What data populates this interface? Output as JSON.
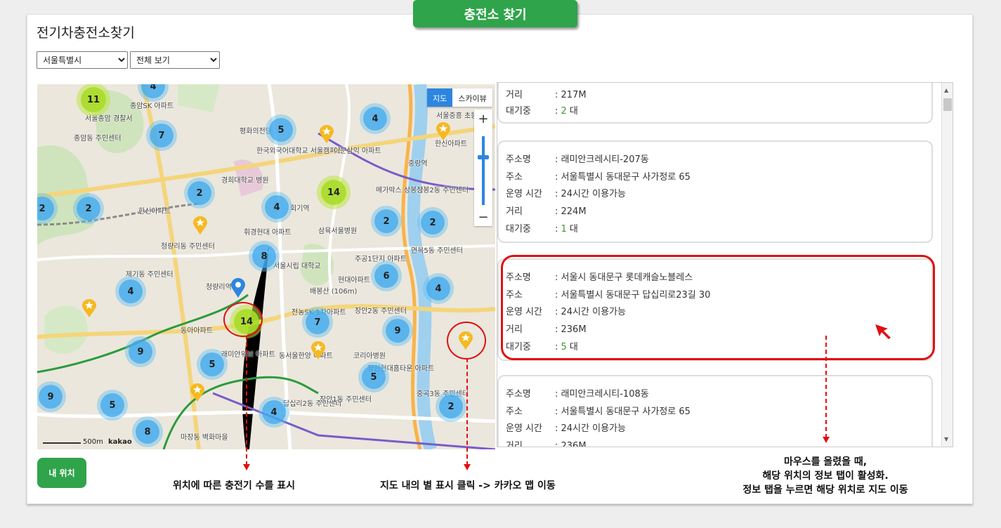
{
  "tag": "충전소 찾기",
  "title": "전기차충전소찾기",
  "filters": {
    "region": "서울특별시",
    "view": "전체 보기"
  },
  "map": {
    "type_buttons": [
      "지도",
      "스카이뷰"
    ],
    "zoom_in": "+",
    "zoom_out": "−",
    "scale_label": "500m",
    "brand": "kakao",
    "clusters": [
      {
        "count": "11",
        "color": "green"
      },
      {
        "count": "4",
        "color": "blue"
      },
      {
        "count": "7",
        "color": "blue"
      },
      {
        "count": "5",
        "color": "blue"
      },
      {
        "count": "4",
        "color": "blue"
      },
      {
        "count": "2",
        "color": "blue"
      },
      {
        "count": "14",
        "color": "green"
      },
      {
        "count": "2",
        "color": "blue"
      },
      {
        "count": "4",
        "color": "blue"
      },
      {
        "count": "2",
        "color": "blue"
      },
      {
        "count": "2",
        "color": "blue"
      },
      {
        "count": "8",
        "color": "blue"
      },
      {
        "count": "6",
        "color": "blue"
      },
      {
        "count": "4",
        "color": "blue"
      },
      {
        "count": "4",
        "color": "blue"
      },
      {
        "count": "14",
        "color": "green"
      },
      {
        "count": "7",
        "color": "blue"
      },
      {
        "count": "9",
        "color": "blue"
      },
      {
        "count": "9",
        "color": "blue"
      },
      {
        "count": "5",
        "color": "blue"
      },
      {
        "count": "5",
        "color": "blue"
      },
      {
        "count": "9",
        "color": "blue"
      },
      {
        "count": "5",
        "color": "blue"
      },
      {
        "count": "4",
        "color": "blue"
      },
      {
        "count": "8",
        "color": "blue"
      },
      {
        "count": "2",
        "color": "blue"
      },
      {
        "count": "2",
        "color": "blue"
      }
    ],
    "labels": [
      "종암SK 아파트",
      "서울종암 경찰서",
      "종암동 주민센터",
      "평화의전당",
      "한국외국어대학교 서울캠퍼스",
      "이문삼익 아파트",
      "서울중흥 초등학교",
      "한신아파트",
      "중랑역",
      "경희대학교 병원",
      "메가박스 상봉점",
      "상봉2동 주민센터",
      "회기역",
      "한신아파트",
      "청량리동 주민센터",
      "휘경현대 아파트",
      "삼육서울병원",
      "면목5동 주민센터",
      "주공1단지 아파트",
      "서울시립 대학교",
      "제기동 주민센터",
      "청량리역",
      "배봉산 (106m)",
      "현대아파트",
      "장안2동 주민센터",
      "전농SK 1차아파트",
      "동아아파트",
      "래미안위브 아파트",
      "동서울한양 아파트",
      "코리아병원",
      "장안현대홈타운 아파트",
      "중곡3동 주민센터",
      "답십리2동 주민센터",
      "장안1동 주민센터",
      "마장동 벽화마을"
    ]
  },
  "stations": [
    {
      "name": "",
      "address": "",
      "hours": "",
      "distance": "217M",
      "waiting_num": "2",
      "waiting_unit": " 대"
    },
    {
      "name": "래미안크레시티-207동",
      "address": "서울특별시 동대문구 사가정로 65",
      "hours": "24시간 이용가능",
      "distance": "224M",
      "waiting_num": "1",
      "waiting_unit": " 대"
    },
    {
      "name": "서울시 동대문구 롯데캐슬노블레스",
      "address": "서울특별시 동대문구 답십리로23길 30",
      "hours": "24시간 이용가능",
      "distance": "236M",
      "waiting_num": "5",
      "waiting_unit": " 대"
    },
    {
      "name": "래미안크레시티-108동",
      "address": "서울특별시 동대문구 사가정로 65",
      "hours": "24시간 이용가능",
      "distance": "236M",
      "waiting_num": "",
      "waiting_unit": ""
    }
  ],
  "field_labels": {
    "name": "주소명",
    "address": "주소",
    "hours": "운영 시간",
    "distance": "거리",
    "waiting": "대기중"
  },
  "my_location_button": "내 위치",
  "annotations": {
    "note1": "위치에 따른 충전기 수를 표시",
    "note2": "지도 내의 별 표시 클릭 -> 카카오 맵 이동",
    "note3_line1": "마우스를 올렸을 때,",
    "note3_line2": "해당 위치의 정보 탭이 활성화.",
    "note3_line3": "정보 탭을 누르면 해당 위치로 지도 이동"
  },
  "colors": {
    "accent": "#2fa44a",
    "highlight": "#e01010",
    "cluster_blue": "#42aaee",
    "cluster_green": "#aadc28",
    "star": "#f5b921",
    "map_blue": "#2d85e0"
  }
}
